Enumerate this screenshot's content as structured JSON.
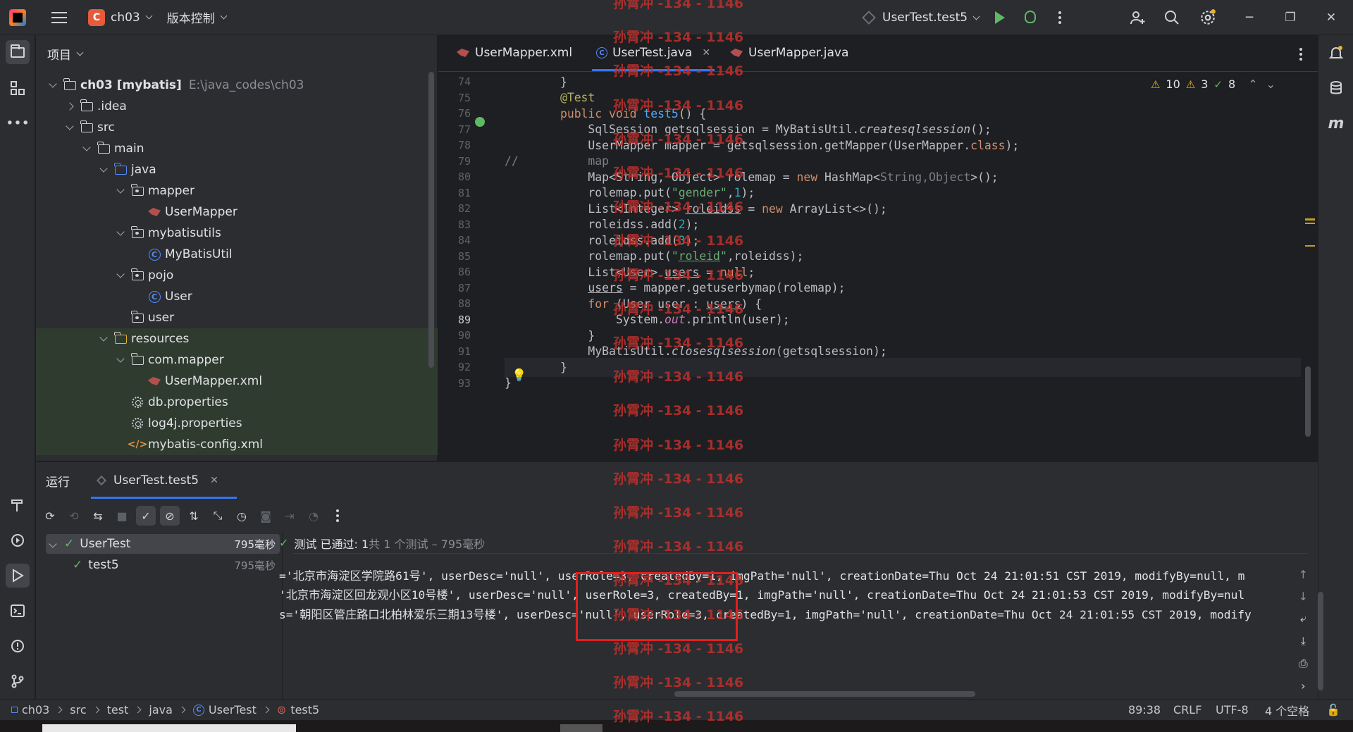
{
  "titlebar": {
    "project_badge": "C",
    "project_name": "ch03",
    "vcs_label": "版本控制",
    "run_config": "UserTest.test5"
  },
  "project_panel": {
    "title": "项目",
    "root_name": "ch03 [mybatis]",
    "root_path": "E:\\java_codes\\ch03",
    "items": [
      ".idea",
      "src",
      "main",
      "java",
      "mapper",
      "UserMapper",
      "mybatisutils",
      "MyBatisUtil",
      "pojo",
      "User",
      "user",
      "resources",
      "com.mapper",
      "UserMapper.xml",
      "db.properties",
      "log4j.properties",
      "mybatis-config.xml"
    ]
  },
  "editor": {
    "tabs": [
      {
        "label": "UserMapper.xml"
      },
      {
        "label": "UserTest.java"
      },
      {
        "label": "UserMapper.java"
      }
    ],
    "inspections": {
      "warnings": "10",
      "weak_warnings": "3",
      "ok": "8"
    },
    "line_numbers": [
      "74",
      "75",
      "76",
      "77",
      "78",
      "79",
      "80",
      "81",
      "82",
      "83",
      "84",
      "85",
      "86",
      "87",
      "88",
      "89",
      "90",
      "91",
      "92",
      "93"
    ],
    "current_line": "89"
  },
  "run_panel": {
    "title": "运行",
    "tab_label": "UserTest.test5",
    "pass_summary": "测试 已通过: 1",
    "pass_detail": "共 1 个测试 – 795毫秒",
    "tests": [
      {
        "name": "UserTest",
        "time": "795毫秒"
      },
      {
        "name": "test5",
        "time": "795毫秒"
      }
    ],
    "output_lines": [
      "='北京市海淀区学院路61号', userDesc='null', userRole=3, createdBy=1, imgPath='null', creationDate=Thu Oct 24 21:01:51 CST 2019, modifyBy=null, m",
      "'北京市海淀区回龙观小区10号楼', userDesc='null', userRole=3, createdBy=1, imgPath='null', creationDate=Thu Oct 24 21:01:53 CST 2019, modifyBy=nul",
      "s='朝阳区管庄路口北柏林爱乐三期13号楼', userDesc='null', userRole=3, createdBy=1, imgPath='null', creationDate=Thu Oct 24 21:01:55 CST 2019, modify"
    ]
  },
  "statusbar": {
    "breadcrumb": [
      "ch03",
      "src",
      "test",
      "java",
      "UserTest",
      "test5"
    ],
    "position": "89:38",
    "line_sep": "CRLF",
    "encoding": "UTF-8",
    "indent": "4 个空格"
  },
  "watermark": "孙霄冲 -134 - 1146"
}
